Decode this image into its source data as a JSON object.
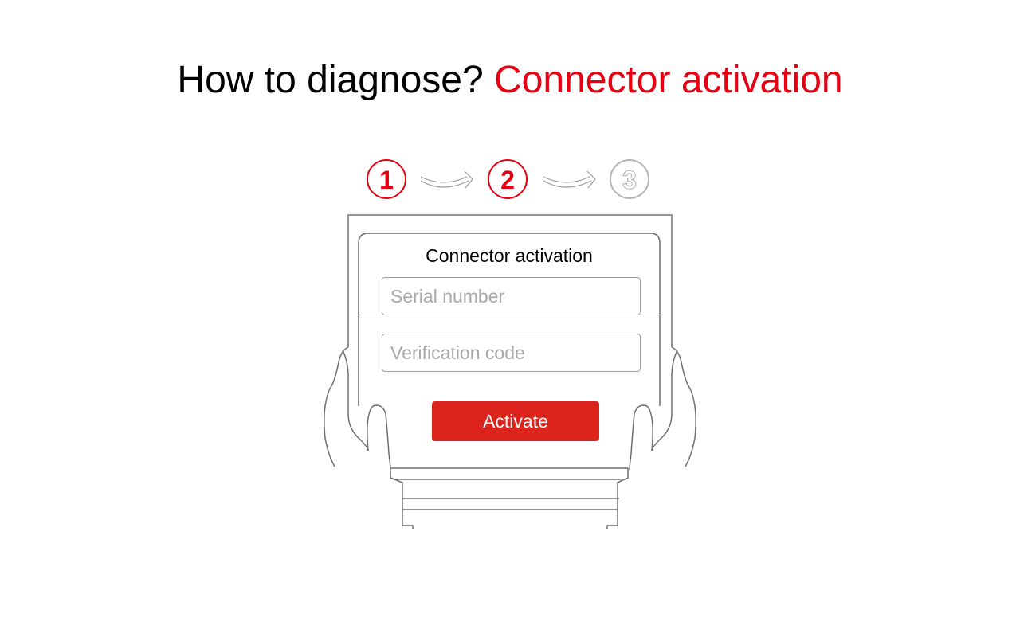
{
  "heading": {
    "prefix": "How to diagnose?",
    "highlight": "Connector activation"
  },
  "steps": [
    {
      "number": "1",
      "state": "active",
      "color": "#e60012"
    },
    {
      "number": "2",
      "state": "active",
      "color": "#e60012"
    },
    {
      "number": "3",
      "state": "inactive",
      "color": "#b4b4b4"
    }
  ],
  "form": {
    "title": "Connector activation",
    "serial_placeholder": "Serial number",
    "verification_placeholder": "Verification code",
    "activate_label": "Activate"
  },
  "colors": {
    "accent": "#e60012",
    "button": "#dc241c",
    "outline": "#6e6e6e"
  },
  "icons": [
    "arrow-right-icon",
    "hand-icon",
    "tablet-device-icon"
  ]
}
